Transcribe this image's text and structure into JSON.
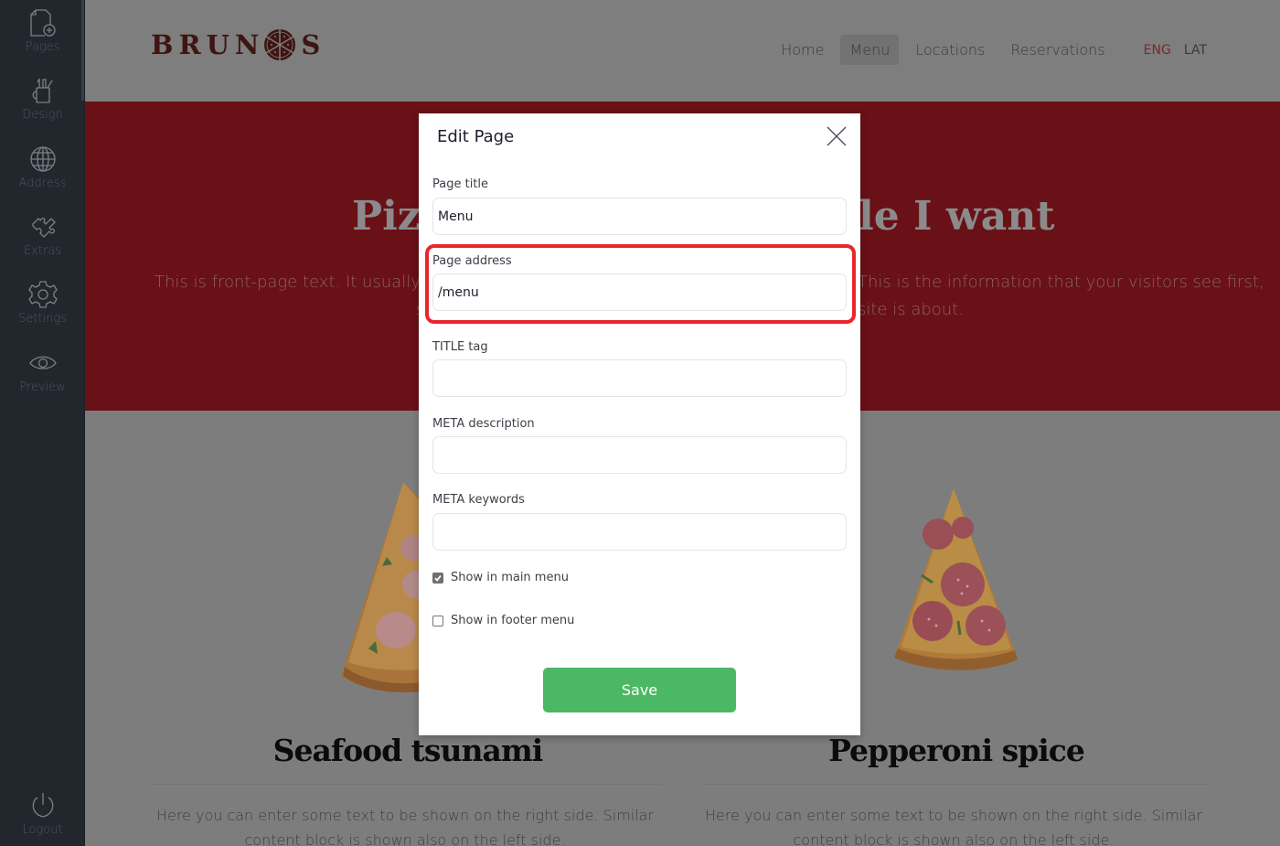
{
  "sidebar": {
    "items": [
      {
        "label": "Pages",
        "icon": "page-add-icon"
      },
      {
        "label": "Design",
        "icon": "design-tools-icon"
      },
      {
        "label": "Address",
        "icon": "globe-icon"
      },
      {
        "label": "Extras",
        "icon": "puzzle-icon"
      },
      {
        "label": "Settings",
        "icon": "gear-icon"
      },
      {
        "label": "Preview",
        "icon": "eye-icon"
      }
    ],
    "logout": {
      "label": "Logout",
      "icon": "power-icon"
    }
  },
  "site": {
    "logo": {
      "text_left": "BRUN",
      "text_right": "S"
    },
    "nav": [
      {
        "label": "Home",
        "active": false
      },
      {
        "label": "Menu",
        "active": true
      },
      {
        "label": "Locations",
        "active": false
      },
      {
        "label": "Reservations",
        "active": false
      }
    ],
    "languages": {
      "eng": "ENG",
      "lat": "LAT"
    },
    "hero": {
      "title_left": "Pizz",
      "title_right": "le I want",
      "text_left_line1": "This is front-page text. It usually has",
      "text_left_line2": "s",
      "text_right_line1": "This is the information that your visitors see first,",
      "text_right_line2": "site is about."
    },
    "cards": [
      {
        "title": "Seafood tsunami",
        "text": "Here you can enter some text to be shown on the right side. Similar content block is shown also on the left side."
      },
      {
        "title": "Pepperoni spice",
        "text": "Here you can enter some text to be shown on the right side. Similar content block is shown also on the left side."
      }
    ]
  },
  "modal": {
    "title": "Edit Page",
    "fields": {
      "page_title": {
        "label": "Page title",
        "value": "Menu"
      },
      "page_address": {
        "label": "Page address",
        "value": "/menu"
      },
      "title_tag": {
        "label": "TITLE tag",
        "value": ""
      },
      "meta_description": {
        "label": "META description",
        "value": ""
      },
      "meta_keywords": {
        "label": "META keywords",
        "value": ""
      }
    },
    "checkboxes": {
      "main_menu": {
        "label": "Show in main menu",
        "checked": true
      },
      "footer_menu": {
        "label": "Show in footer menu",
        "checked": false
      }
    },
    "save_label": "Save"
  },
  "colors": {
    "sidebar_bg": "#22272e",
    "hero_bg": "#6a1017",
    "save_green": "#4cb865",
    "highlight_red": "#e8262c"
  }
}
